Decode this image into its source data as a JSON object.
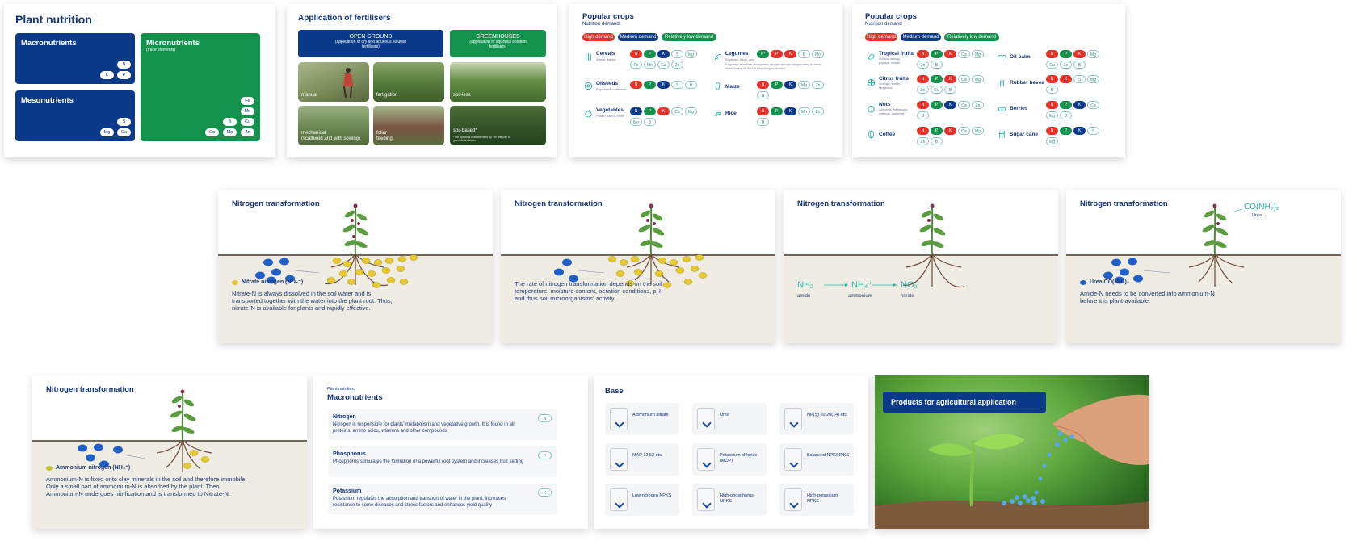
{
  "plant_nutrition": {
    "title": "Plant nutrition",
    "macro": {
      "title": "Macronutrients",
      "elements": [
        "N",
        "K",
        "P"
      ]
    },
    "micro": {
      "title": "Micronutrients",
      "subtitle": "(trace elements)",
      "elements": [
        "Fe",
        "Mn",
        "B",
        "Cu",
        "Co",
        "Mo",
        "Zn"
      ]
    },
    "meso": {
      "title": "Mesonutrients",
      "elements": [
        "S",
        "Mg",
        "Ca"
      ]
    }
  },
  "fertilisers": {
    "title": "Application of fertilisers",
    "open_ground": {
      "title": "OPEN GROUND",
      "desc": "(application of dry and aqueous solution fertilisers)"
    },
    "greenhouses": {
      "title": "GREENHOUSES",
      "desc": "(application of aqueous solution fertilisers)"
    },
    "photos": [
      "manual",
      "fertigation",
      "soil-less",
      "mechanical\n(scattered and with sowing)",
      "foliar feeding",
      "soil-based*"
    ],
    "footnote": "* the option is characterized by \"fill\" the use of granular fertilisers"
  },
  "crops1": {
    "title": "Popular crops",
    "subtitle": "Nutrition demand",
    "legend": [
      "High demand",
      "Medium demand",
      "Relatively low demand"
    ],
    "cereals": {
      "name": "Cereals",
      "sub": "Wheat, barley"
    },
    "legumes": {
      "name": "Legumes",
      "sub": "Soybean, bean, pea",
      "note": "*Legumes assimilate atmospheric nitrogen through nitrogen fixing bacteria, which covers 30-60% of total nitrogen demand"
    },
    "oilseeds": {
      "name": "Oilseeds",
      "sub": "Rapeseed, sunflower"
    },
    "maize": {
      "name": "Maize"
    },
    "vegetables": {
      "name": "Vegetables",
      "sub": "Potato, carrot, beet"
    },
    "rice": {
      "name": "Rice"
    },
    "el": {
      "N": "N",
      "Ns": "N*",
      "P": "P",
      "K": "K",
      "S": "S",
      "Mg": "Mg",
      "Fe": "Fe",
      "Mn": "Mn",
      "Cu": "Cu",
      "Zn": "Zn",
      "B": "B",
      "Ca": "Ca",
      "Mo": "Mo",
      "Co": "Co"
    }
  },
  "crops2": {
    "title": "Popular crops",
    "subtitle": "Nutrition demand",
    "legend": [
      "High demand",
      "Medium demand",
      "Relatively low demand"
    ],
    "tropical": {
      "name": "Tropical fruits",
      "sub": "Guava, mango, papaya, durian"
    },
    "oilpalm": {
      "name": "Oil palm"
    },
    "citrus": {
      "name": "Citrus fruits",
      "sub": "Orange, lemon, tangerine"
    },
    "rubber": {
      "name": "Rubber hevea"
    },
    "nuts": {
      "name": "Nuts",
      "sub": "Almonds, hazelnuts, walnuts, cashews"
    },
    "berries": {
      "name": "Berries"
    },
    "coffee": {
      "name": "Coffee"
    },
    "sugar": {
      "name": "Sugar cane"
    }
  },
  "nitro": {
    "title": "Nitrogen transformation",
    "s1": {
      "legend": "Nitrate nitrogen (NO₃⁻)",
      "text": "Nitrate-N is always dissolved in the soil water and is transported together with the water into the plant root. Thus, nitrate-N is available for plants and rapidly effective."
    },
    "s2": {
      "text": "The rate of nitrogen transformation depends on the soil temperature, moisture content, aeration conditions, pH and thus soil microorganisms' activity."
    },
    "s3": {
      "nh2": "NH₂",
      "nh4": "NH₄⁺",
      "no3": "NO₃⁻",
      "amide": "amide",
      "ammonium": "ammonium",
      "nitrate": "nitrate"
    },
    "s4": {
      "formula": "CO(NH₂)₂",
      "urea": "Urea",
      "legend": "Urea CO(NH₂)₂",
      "text": "Amide-N needs to be converted into ammonium-N before it is plant-available."
    },
    "s5": {
      "legend": "Ammonium nitrogen (NH₄⁺)",
      "text": "Ammonium-N is fixed onto clay minerals in the soil and therefore immobile. Only a small part of ammonium-N is absorbed by the plant. Then Ammonium-N undergoes nitrification and is transformed to Nitrate-N."
    }
  },
  "macros": {
    "breadcrumb": "Plant nutrition",
    "title": "Macronutrients",
    "items": [
      {
        "name": "Nitrogen",
        "badge": "N",
        "text": "Nitrogen is responsible for plants' metabolism and vegetative growth. It is found in all proteins, amino acids, vitamins and other compounds"
      },
      {
        "name": "Phosphorus",
        "badge": "P",
        "text": "Phosphorus stimulates the formation of a powerful root system and increases fruit setting"
      },
      {
        "name": "Potassium",
        "badge": "K",
        "text": "Potassium regulates the absorption and transport of water in the plant, increases resistance to some diseases and stress factors  and enhances yield quality"
      }
    ]
  },
  "base": {
    "title": "Base",
    "products": [
      "Ammonium nitrate",
      "Urea",
      "NP(S) 20:20(14) etc.",
      "MAP 12:52 etc.",
      "Potassium chloride (MOP)",
      "Balanced NPK/NPKS",
      "Low-nitrogen NPKS",
      "High-phosphorus NPKS",
      "High-potassium NPKS"
    ]
  },
  "products": {
    "title": "Products for agricultural application"
  },
  "colors": {
    "navy": "#0b3a8a",
    "green": "#12924d",
    "red": "#e5332a",
    "teal": "#2bb3a6",
    "nitrate": "#e6c92e",
    "urea": "#1f5fc7"
  }
}
